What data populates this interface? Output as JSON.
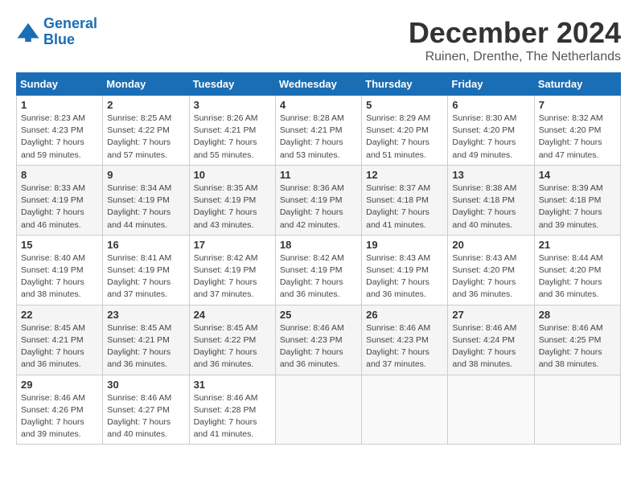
{
  "header": {
    "logo_line1": "General",
    "logo_line2": "Blue",
    "month_title": "December 2024",
    "location": "Ruinen, Drenthe, The Netherlands"
  },
  "days_of_week": [
    "Sunday",
    "Monday",
    "Tuesday",
    "Wednesday",
    "Thursday",
    "Friday",
    "Saturday"
  ],
  "weeks": [
    [
      {
        "day": 1,
        "info": "Sunrise: 8:23 AM\nSunset: 4:23 PM\nDaylight: 7 hours\nand 59 minutes."
      },
      {
        "day": 2,
        "info": "Sunrise: 8:25 AM\nSunset: 4:22 PM\nDaylight: 7 hours\nand 57 minutes."
      },
      {
        "day": 3,
        "info": "Sunrise: 8:26 AM\nSunset: 4:21 PM\nDaylight: 7 hours\nand 55 minutes."
      },
      {
        "day": 4,
        "info": "Sunrise: 8:28 AM\nSunset: 4:21 PM\nDaylight: 7 hours\nand 53 minutes."
      },
      {
        "day": 5,
        "info": "Sunrise: 8:29 AM\nSunset: 4:20 PM\nDaylight: 7 hours\nand 51 minutes."
      },
      {
        "day": 6,
        "info": "Sunrise: 8:30 AM\nSunset: 4:20 PM\nDaylight: 7 hours\nand 49 minutes."
      },
      {
        "day": 7,
        "info": "Sunrise: 8:32 AM\nSunset: 4:20 PM\nDaylight: 7 hours\nand 47 minutes."
      }
    ],
    [
      {
        "day": 8,
        "info": "Sunrise: 8:33 AM\nSunset: 4:19 PM\nDaylight: 7 hours\nand 46 minutes."
      },
      {
        "day": 9,
        "info": "Sunrise: 8:34 AM\nSunset: 4:19 PM\nDaylight: 7 hours\nand 44 minutes."
      },
      {
        "day": 10,
        "info": "Sunrise: 8:35 AM\nSunset: 4:19 PM\nDaylight: 7 hours\nand 43 minutes."
      },
      {
        "day": 11,
        "info": "Sunrise: 8:36 AM\nSunset: 4:19 PM\nDaylight: 7 hours\nand 42 minutes."
      },
      {
        "day": 12,
        "info": "Sunrise: 8:37 AM\nSunset: 4:18 PM\nDaylight: 7 hours\nand 41 minutes."
      },
      {
        "day": 13,
        "info": "Sunrise: 8:38 AM\nSunset: 4:18 PM\nDaylight: 7 hours\nand 40 minutes."
      },
      {
        "day": 14,
        "info": "Sunrise: 8:39 AM\nSunset: 4:18 PM\nDaylight: 7 hours\nand 39 minutes."
      }
    ],
    [
      {
        "day": 15,
        "info": "Sunrise: 8:40 AM\nSunset: 4:19 PM\nDaylight: 7 hours\nand 38 minutes."
      },
      {
        "day": 16,
        "info": "Sunrise: 8:41 AM\nSunset: 4:19 PM\nDaylight: 7 hours\nand 37 minutes."
      },
      {
        "day": 17,
        "info": "Sunrise: 8:42 AM\nSunset: 4:19 PM\nDaylight: 7 hours\nand 37 minutes."
      },
      {
        "day": 18,
        "info": "Sunrise: 8:42 AM\nSunset: 4:19 PM\nDaylight: 7 hours\nand 36 minutes."
      },
      {
        "day": 19,
        "info": "Sunrise: 8:43 AM\nSunset: 4:19 PM\nDaylight: 7 hours\nand 36 minutes."
      },
      {
        "day": 20,
        "info": "Sunrise: 8:43 AM\nSunset: 4:20 PM\nDaylight: 7 hours\nand 36 minutes."
      },
      {
        "day": 21,
        "info": "Sunrise: 8:44 AM\nSunset: 4:20 PM\nDaylight: 7 hours\nand 36 minutes."
      }
    ],
    [
      {
        "day": 22,
        "info": "Sunrise: 8:45 AM\nSunset: 4:21 PM\nDaylight: 7 hours\nand 36 minutes."
      },
      {
        "day": 23,
        "info": "Sunrise: 8:45 AM\nSunset: 4:21 PM\nDaylight: 7 hours\nand 36 minutes."
      },
      {
        "day": 24,
        "info": "Sunrise: 8:45 AM\nSunset: 4:22 PM\nDaylight: 7 hours\nand 36 minutes."
      },
      {
        "day": 25,
        "info": "Sunrise: 8:46 AM\nSunset: 4:23 PM\nDaylight: 7 hours\nand 36 minutes."
      },
      {
        "day": 26,
        "info": "Sunrise: 8:46 AM\nSunset: 4:23 PM\nDaylight: 7 hours\nand 37 minutes."
      },
      {
        "day": 27,
        "info": "Sunrise: 8:46 AM\nSunset: 4:24 PM\nDaylight: 7 hours\nand 38 minutes."
      },
      {
        "day": 28,
        "info": "Sunrise: 8:46 AM\nSunset: 4:25 PM\nDaylight: 7 hours\nand 38 minutes."
      }
    ],
    [
      {
        "day": 29,
        "info": "Sunrise: 8:46 AM\nSunset: 4:26 PM\nDaylight: 7 hours\nand 39 minutes."
      },
      {
        "day": 30,
        "info": "Sunrise: 8:46 AM\nSunset: 4:27 PM\nDaylight: 7 hours\nand 40 minutes."
      },
      {
        "day": 31,
        "info": "Sunrise: 8:46 AM\nSunset: 4:28 PM\nDaylight: 7 hours\nand 41 minutes."
      },
      null,
      null,
      null,
      null
    ]
  ]
}
